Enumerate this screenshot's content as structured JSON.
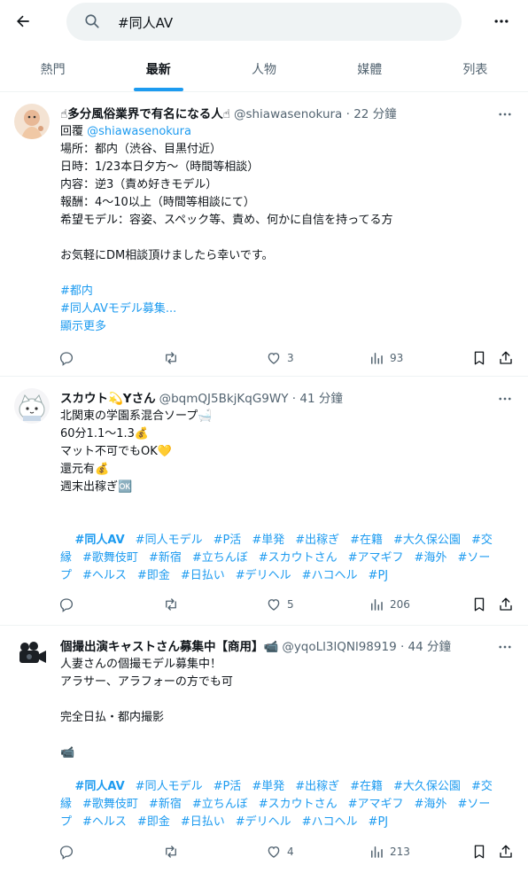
{
  "header": {
    "search_value": "#同人AV"
  },
  "tabs": [
    {
      "label": "熱門"
    },
    {
      "label": "最新"
    },
    {
      "label": "人物"
    },
    {
      "label": "媒體"
    },
    {
      "label": "列表"
    }
  ],
  "tweets": [
    {
      "name": "☝多分風俗業界で有名になる人☝",
      "handle": "@shiawasenokura · 22 分鐘",
      "reply_prefix": "回覆 ",
      "reply_to": "@shiawasenokura",
      "body": "場所：都内（渋谷、目黒付近）\n日時：1/23本日夕方〜（時間等相談）\n内容：逆3（責め好きモデル）\n報酬：4〜10以上（時間等相談にて）\n希望モデル：容姿、スペック等、責め、何かに自信を持ってる方\n\nお気軽にDM相談頂けましたら幸いです。",
      "tag1": "#都内",
      "tag2": "#同人AVモデル募集...",
      "show_more": "顯示更多",
      "replies": "",
      "retweets": "",
      "likes": "3",
      "views": "93"
    },
    {
      "name": "スカウト💫Yさん",
      "handle": "@bqmQJ5BkjKqG9WY · 41 分鐘",
      "body": "北関東の学園系混合ソープ🛁\n60分1.1〜1.3💰\nマット不可でもOK💛\n還元有💰\n週末出稼ぎ🆗",
      "tags": [
        "#同人AV",
        "#同人モデル",
        "#P活",
        "#単発",
        "#出稼ぎ",
        "#在籍",
        "#大久保公園",
        "#交縁",
        "#歌舞伎町",
        "#新宿",
        "#立ちんぼ",
        "#スカウトさん",
        "#アマギフ",
        "#海外",
        "#ソープ",
        "#ヘルス",
        "#即金",
        "#日払い",
        "#デリヘル",
        "#ハコヘル",
        "#PJ"
      ],
      "likes": "5",
      "views": "206"
    },
    {
      "name": "個撮出演キャストさん募集中【商用】📹",
      "handle": "@yqoLl3lQNl98919 · 44 分鐘",
      "body": "人妻さんの個撮モデル募集中！\nアラサー、アラフォーの方でも可\n\n完全日払・都内撮影\n\n📹",
      "tags": [
        "#同人AV",
        "#同人モデル",
        "#P活",
        "#単発",
        "#出稼ぎ",
        "#在籍",
        "#大久保公園",
        "#交縁",
        "#歌舞伎町",
        "#新宿",
        "#立ちんぼ",
        "#スカウトさん",
        "#アマギフ",
        "#海外",
        "#ソープ",
        "#ヘルス",
        "#即金",
        "#日払い",
        "#デリヘル",
        "#ハコヘル",
        "#PJ"
      ],
      "likes": "4",
      "views": "213"
    }
  ],
  "colors": {
    "accent": "#1d9bf0",
    "muted": "#536471",
    "text": "#0f1419"
  },
  "icons": [
    "back-arrow-icon",
    "search-icon",
    "more-icon",
    "reply-icon",
    "retweet-icon",
    "like-icon",
    "views-icon",
    "bookmark-icon",
    "share-icon"
  ]
}
